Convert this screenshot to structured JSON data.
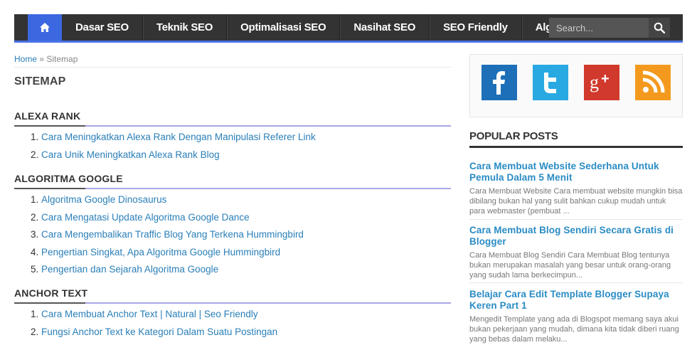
{
  "nav": {
    "items": [
      "Dasar SEO",
      "Teknik SEO",
      "Optimalisasi SEO",
      "Nasihat SEO",
      "SEO Friendly",
      "Algoritma Google"
    ],
    "search_placeholder": "Search..."
  },
  "breadcrumb": {
    "home": "Home",
    "sep": " » ",
    "current": "Sitemap"
  },
  "page_title": "SITEMAP",
  "sections": [
    {
      "title": "ALEXA RANK",
      "links": [
        "Cara Meningkatkan Alexa Rank Dengan Manipulasi Referer Link",
        "Cara Unik Meningkatkan Alexa Rank Blog"
      ]
    },
    {
      "title": "ALGORITMA GOOGLE",
      "links": [
        "Algoritma Google Dinosaurus",
        "Cara Mengatasi Update Algoritma Google Dance",
        "Cara Mengembalikan Traffic Blog Yang Terkena Hummingbird",
        "Pengertian Singkat, Apa Algoritma Google Hummingbird",
        "Pengertian dan Sejarah Algoritma Google"
      ]
    },
    {
      "title": "ANCHOR TEXT",
      "links": [
        "Cara Membuat Anchor Text | Natural | Seo Friendly",
        "Fungsi Anchor Text ke Kategori Dalam Suatu Postingan"
      ]
    }
  ],
  "social": [
    {
      "name": "facebook-icon",
      "color": "#1d6fb8"
    },
    {
      "name": "twitter-icon",
      "color": "#29a9e1"
    },
    {
      "name": "google-plus-icon",
      "color": "#d0392b"
    },
    {
      "name": "rss-icon",
      "color": "#f39a1e"
    }
  ],
  "popular": {
    "title": "POPULAR POSTS",
    "posts": [
      {
        "title": "Cara Membuat Website Sederhana Untuk Pemula Dalam 5 Menit",
        "excerpt": "Cara Membuat Website Cara membuat website mungkin bisa dibilang bukan hal yang sulit bahkan cukup mudah untuk para webmaster (pembuat ..."
      },
      {
        "title": "Cara Membuat Blog Sendiri Secara Gratis di Blogger",
        "excerpt": "Cara Membuat Blog Sendiri Cara Membuat Blog tentunya bukan merupakan masalah yang besar untuk orang-orang yang sudah lama berkecimpun..."
      },
      {
        "title": "Belajar Cara Edit Template Blogger Supaya Keren Part 1",
        "excerpt": "Mengedit Template yang ada di Blogspot memang saya akui bukan pekerjaan yang mudah, dimana kita tidak diberi ruang yang bebas dalam melaku..."
      }
    ]
  }
}
